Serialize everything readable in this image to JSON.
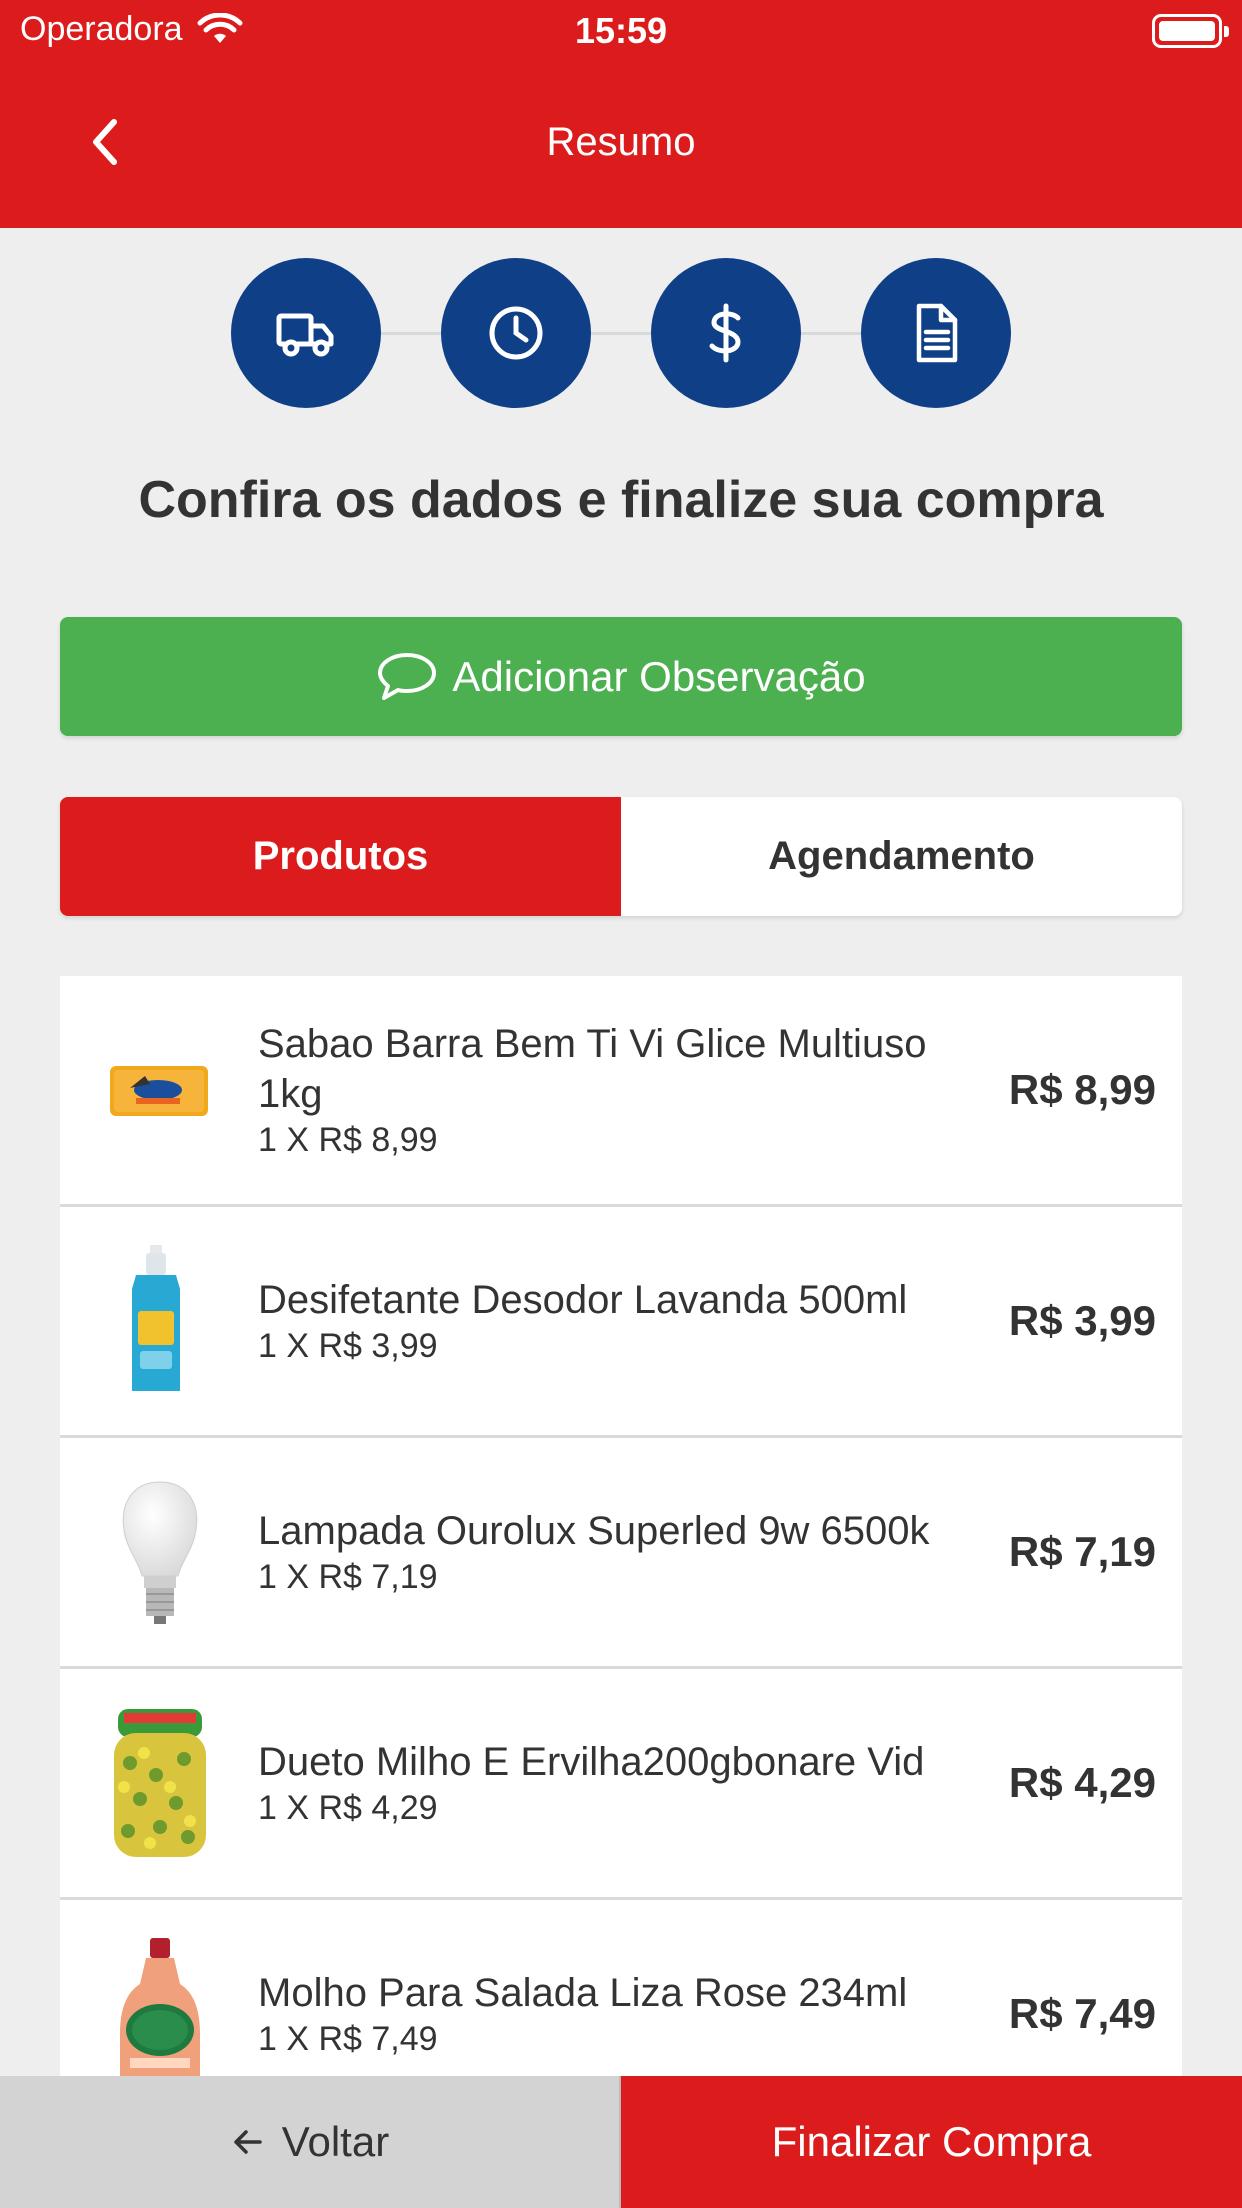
{
  "status_bar": {
    "carrier": "Operadora",
    "time": "15:59"
  },
  "header": {
    "title": "Resumo"
  },
  "steps": [
    {
      "icon": "truck-icon"
    },
    {
      "icon": "clock-icon"
    },
    {
      "icon": "dollar-icon"
    },
    {
      "icon": "document-icon"
    }
  ],
  "main": {
    "heading": "Confira os dados e finalize sua compra",
    "observation_button": "Adicionar Observação",
    "tabs": [
      {
        "label": "Produtos",
        "active": true
      },
      {
        "label": "Agendamento",
        "active": false
      }
    ]
  },
  "products": [
    {
      "name": "Sabao Barra Bem Ti Vi Glice Multiuso 1kg",
      "qty": "1 X R$ 8,99",
      "price": "R$ 8,99"
    },
    {
      "name": "Desifetante Desodor Lavanda 500ml",
      "qty": "1 X R$ 3,99",
      "price": "R$ 3,99"
    },
    {
      "name": "Lampada Ourolux Superled 9w 6500k",
      "qty": "1 X R$ 7,19",
      "price": "R$ 7,19"
    },
    {
      "name": "Dueto Milho E Ervilha200gbonare Vid",
      "qty": "1 X R$ 4,29",
      "price": "R$ 4,29"
    },
    {
      "name": "Molho Para Salada Liza Rose 234ml",
      "qty": "1 X R$ 7,49",
      "price": "R$ 7,49"
    }
  ],
  "footer": {
    "back_label": "Voltar",
    "finish_label": "Finalizar Compra"
  },
  "colors": {
    "brand_red": "#dc1c1c",
    "step_blue": "#0f3f86",
    "green": "#4caf50"
  }
}
